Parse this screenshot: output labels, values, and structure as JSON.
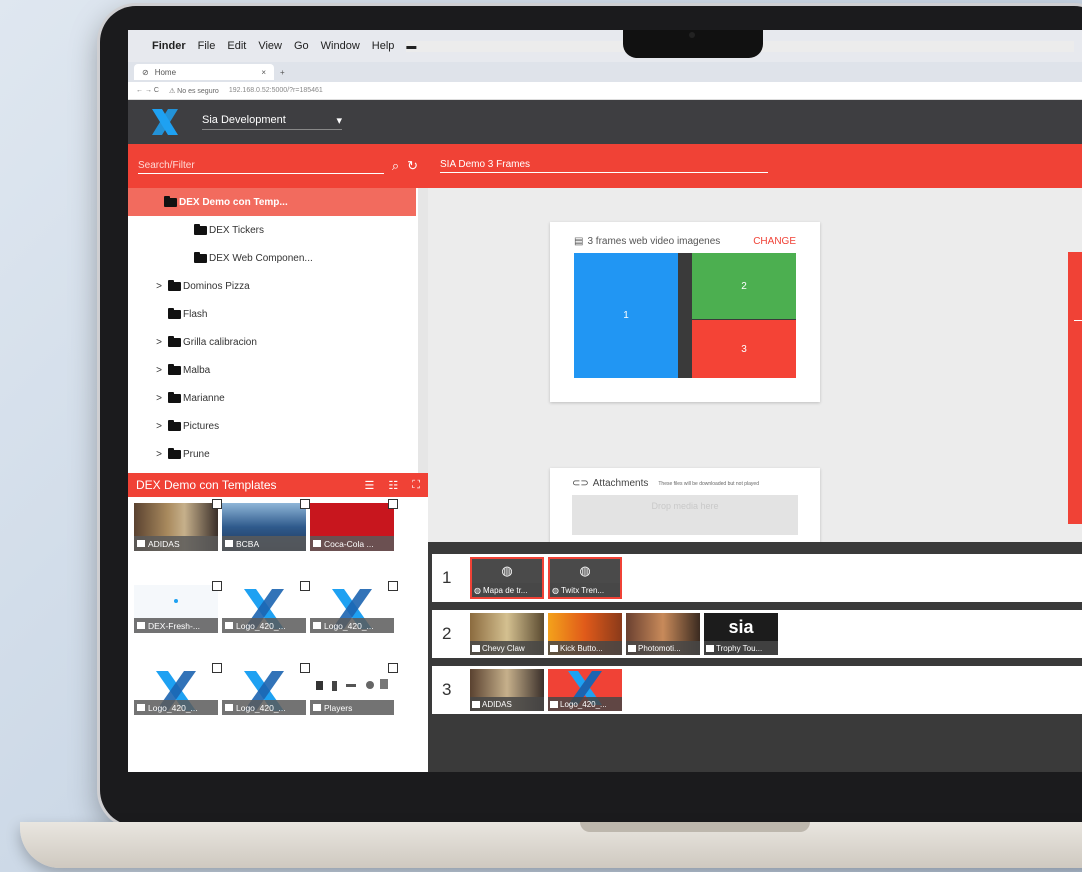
{
  "menubar": {
    "apple": "",
    "app": "Finder",
    "items": [
      "File",
      "Edit",
      "View",
      "Go",
      "Window",
      "Help"
    ]
  },
  "browser": {
    "tab_label": "Home",
    "tab_close": "×",
    "tab_new": "+",
    "nav": "← → C",
    "security": "⚠ No es seguro",
    "url": "192.168.0.52:5000/?r=185461"
  },
  "header": {
    "project": "Sia Development",
    "dropdown_icon": "▾"
  },
  "search": {
    "placeholder": "Search/Filter",
    "search_icon": "⌕",
    "refresh_icon": "↻"
  },
  "tree": {
    "items": [
      {
        "label": "DEX Demo con Temp...",
        "chevron": "",
        "selected": true
      },
      {
        "label": "DEX Tickers",
        "chevron": ""
      },
      {
        "label": "DEX Web Componen...",
        "chevron": ""
      },
      {
        "label": "Dominos Pizza",
        "chevron": ">"
      },
      {
        "label": "Flash",
        "chevron": ""
      },
      {
        "label": "Grilla calibracion",
        "chevron": ">"
      },
      {
        "label": "Malba",
        "chevron": ">"
      },
      {
        "label": "Marianne",
        "chevron": ">"
      },
      {
        "label": "Pictures",
        "chevron": ">"
      },
      {
        "label": "Prune",
        "chevron": ">"
      }
    ]
  },
  "media": {
    "title": "DEX Demo con Templates",
    "view_icons": [
      "☰",
      "☷",
      "⛶"
    ],
    "items": [
      {
        "label": "ADIDAS",
        "color": "#8a6a4a"
      },
      {
        "label": "BCBA",
        "color": "#3c6aa0"
      },
      {
        "label": "Coca-Cola ...",
        "color": "#c8161e"
      },
      {
        "label": "DEX-Fresh-...",
        "color": "#f5f8fb"
      },
      {
        "label": "Logo_420_...",
        "color": "#ffffff"
      },
      {
        "label": "Logo_420_...",
        "color": "#ffffff"
      },
      {
        "label": "Logo_420_...",
        "color": "#ffffff"
      },
      {
        "label": "Logo_420_...",
        "color": "#ffffff"
      },
      {
        "label": "Players",
        "color": "#ffffff"
      }
    ]
  },
  "layout": {
    "title": "SIA Demo 3 Frames",
    "frames_title": "3 frames web video imagenes",
    "change": "CHANGE",
    "frames": [
      "1",
      "2",
      "3"
    ],
    "frame_colors": [
      "#2196f3",
      "#4caf50",
      "#f44336"
    ]
  },
  "attachments": {
    "title": "Attachments",
    "note": "These files will be downloaded but not played",
    "dropzone": "Drop media here"
  },
  "playlists": [
    {
      "num": "1",
      "items": [
        {
          "label": "Mapa de tr...",
          "glyph": "◍",
          "type": "web"
        },
        {
          "label": "Twitx Tren...",
          "glyph": "◍",
          "type": "web"
        }
      ]
    },
    {
      "num": "2",
      "items": [
        {
          "label": "Chevy Claw",
          "glyph": "",
          "type": "video"
        },
        {
          "label": "Kick Butto...",
          "glyph": "",
          "type": "video"
        },
        {
          "label": "Photomoti...",
          "glyph": "",
          "type": "video"
        },
        {
          "label": "Trophy Tou...",
          "glyph": "sia",
          "type": "video"
        }
      ]
    },
    {
      "num": "3",
      "items": [
        {
          "label": "ADIDAS",
          "glyph": "",
          "type": "image"
        },
        {
          "label": "Logo_420_...",
          "glyph": "",
          "type": "image"
        }
      ]
    }
  ],
  "colors": {
    "accent": "#f04236",
    "header": "#3e3e41",
    "selected": "#f26b5e",
    "brand_blue": "#1ea1f2"
  }
}
